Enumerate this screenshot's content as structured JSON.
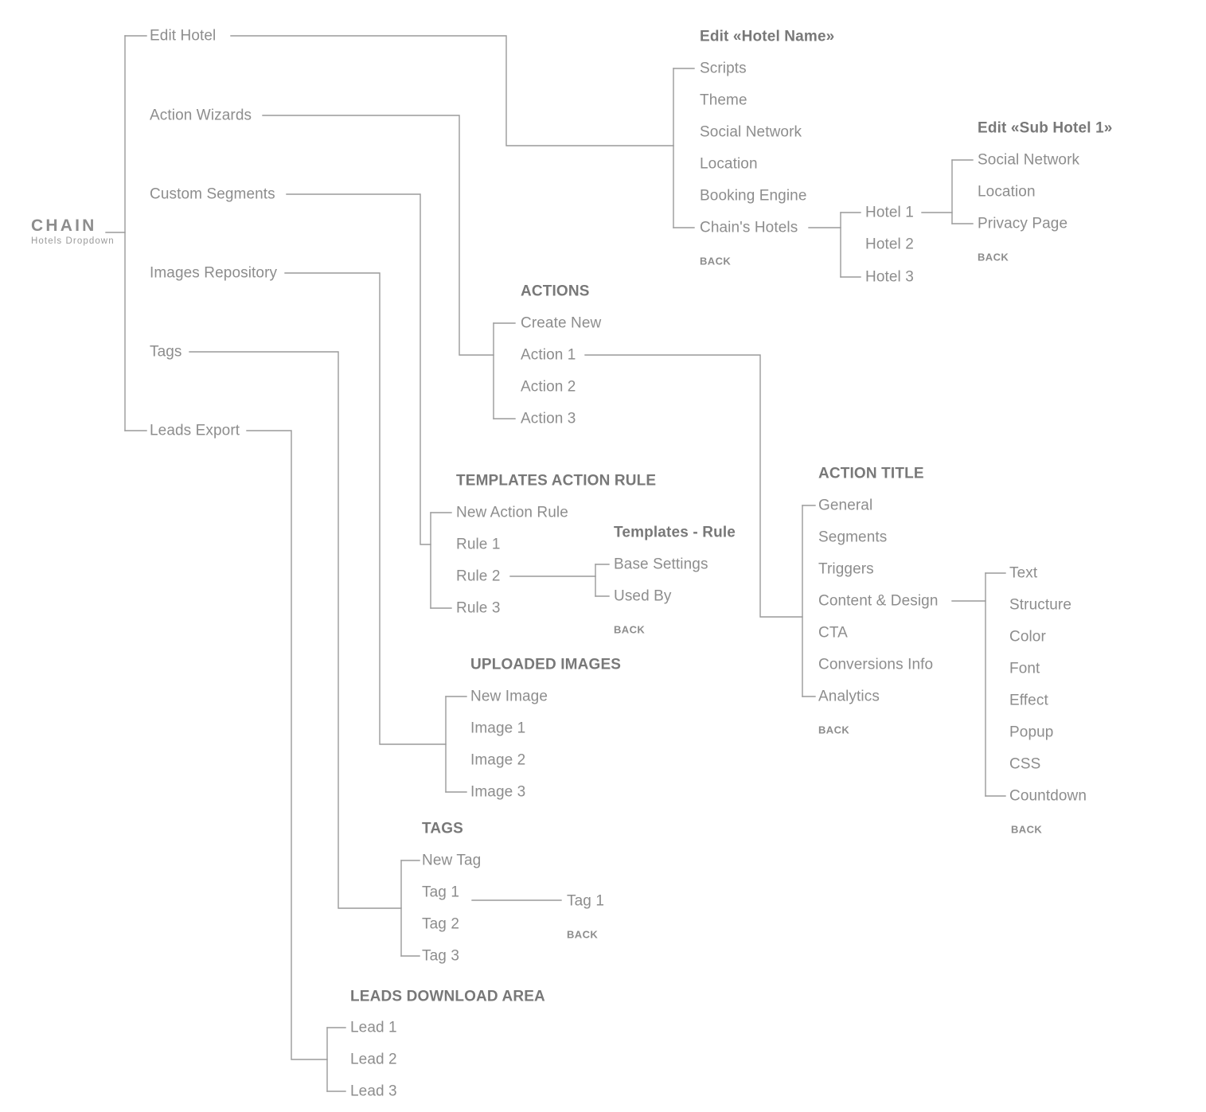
{
  "diagram": {
    "type": "sitemap-tree",
    "background_color": "#ffffff",
    "line_color": "#9a9a9a",
    "text_color": "#8d8d8d",
    "heading_color": "#787878"
  },
  "root": {
    "title": "CHAIN",
    "subtitle": "Hotels Dropdown"
  },
  "level1": {
    "items": [
      {
        "label": "Edit Hotel"
      },
      {
        "label": "Action Wizards"
      },
      {
        "label": "Custom Segments"
      },
      {
        "label": "Images Repository"
      },
      {
        "label": "Tags"
      },
      {
        "label": "Leads Export"
      }
    ]
  },
  "groups": {
    "edit_hotel_name": {
      "title": "Edit «Hotel Name»",
      "items": [
        "Scripts",
        "Theme",
        "Social Network",
        "Location",
        "Booking Engine",
        "Chain's Hotels"
      ],
      "back": "BACK"
    },
    "chains_hotels": {
      "title": "",
      "items": [
        "Hotel 1",
        "Hotel 2",
        "Hotel 3"
      ]
    },
    "edit_sub_hotel": {
      "title": "Edit «Sub Hotel 1»",
      "items": [
        "Social Network",
        "Location",
        "Privacy Page"
      ],
      "back": "BACK"
    },
    "actions": {
      "title": "ACTIONS",
      "items": [
        "Create New",
        "Action 1",
        "Action 2",
        "Action 3"
      ]
    },
    "action_title": {
      "title": "ACTION TITLE",
      "items": [
        "General",
        "Segments",
        "Triggers",
        "Content & Design",
        "CTA",
        "Conversions Info",
        "Analytics"
      ],
      "back": "BACK"
    },
    "content_design": {
      "title": "",
      "items": [
        "Text",
        "Structure",
        "Color",
        "Font",
        "Effect",
        "Popup",
        "CSS",
        "Countdown"
      ],
      "back": "BACK"
    },
    "templates_action_rule": {
      "title": "TEMPLATES ACTION RULE",
      "items": [
        "New Action Rule",
        "Rule 1",
        "Rule 2",
        "Rule 3"
      ]
    },
    "templates_rule": {
      "title": "Templates - Rule",
      "items": [
        "Base Settings",
        "Used By"
      ],
      "back": "BACK"
    },
    "uploaded_images": {
      "title": "UPLOADED IMAGES",
      "items": [
        "New Image",
        "Image 1",
        "Image 2",
        "Image 3"
      ]
    },
    "tags": {
      "title": "TAGS",
      "items": [
        "New Tag",
        "Tag 1",
        "Tag 2",
        "Tag 3"
      ]
    },
    "tag_detail": {
      "title": "",
      "items": [
        "Tag 1"
      ],
      "back": "BACK"
    },
    "leads_download_area": {
      "title": "LEADS DOWNLOAD AREA",
      "items": [
        "Lead 1",
        "Lead 2",
        "Lead 3"
      ]
    }
  }
}
